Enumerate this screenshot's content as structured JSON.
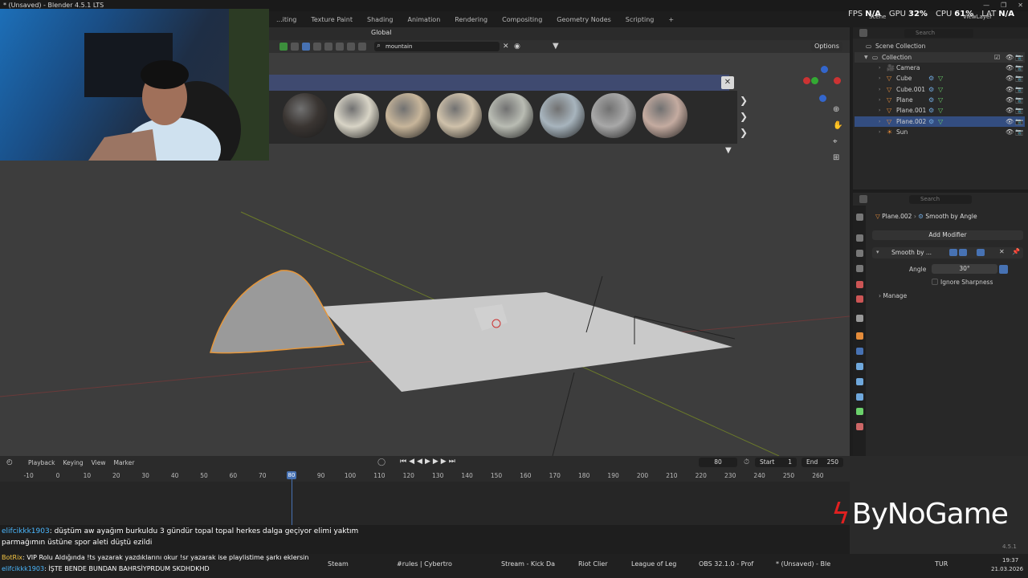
{
  "window": {
    "title": "* (Unsaved) - Blender 4.5.1 LTS"
  },
  "workspace_tabs": [
    "...iting",
    "Texture Paint",
    "Shading",
    "Animation",
    "Rendering",
    "Compositing",
    "Geometry Nodes",
    "Scripting",
    "+"
  ],
  "stats": {
    "fps_label": "FPS",
    "fps": "N/A",
    "gpu_label": "GPU",
    "gpu": "32%",
    "cpu_label": "CPU",
    "cpu": "61%",
    "lat_label": "LAT",
    "lat": "N/A"
  },
  "viewport": {
    "orientation": "Global",
    "search_value": "mountain",
    "options_label": "Options",
    "gizmo_axes": [
      "X",
      "Y",
      "Z"
    ]
  },
  "asset_shelf": {
    "materials": [
      {
        "color": "#3a3532"
      },
      {
        "color": "#d8d4c6"
      },
      {
        "color": "#c7b59a"
      },
      {
        "color": "#cfc1aa"
      },
      {
        "color": "#b9bcb3"
      },
      {
        "color": "#a7b4bd"
      },
      {
        "color": "#a8a8a8"
      },
      {
        "color": "#c4aba0"
      }
    ]
  },
  "outliner": {
    "search_placeholder": "Search",
    "scene_collection": "Scene Collection",
    "collection": "Collection",
    "objects": [
      {
        "name": "Camera",
        "icon": "camera-icon"
      },
      {
        "name": "Cube",
        "icon": "mesh-icon"
      },
      {
        "name": "Cube.001",
        "icon": "mesh-icon"
      },
      {
        "name": "Plane",
        "icon": "mesh-icon"
      },
      {
        "name": "Plane.001",
        "icon": "mesh-icon"
      },
      {
        "name": "Plane.002",
        "icon": "mesh-icon",
        "selected": true
      },
      {
        "name": "Sun",
        "icon": "light-icon"
      }
    ],
    "header_scene": "Scene",
    "header_view_layer": "ViewLayer"
  },
  "properties": {
    "search_placeholder": "Search",
    "breadcrumb_object": "Plane.002",
    "breadcrumb_modifier": "Smooth by Angle",
    "add_modifier_label": "Add Modifier",
    "modifier_name": "Smooth by ...",
    "angle_label": "Angle",
    "angle_value": "30°",
    "ignore_sharpness_label": "Ignore Sharpness",
    "manage_label": "Manage"
  },
  "timeline": {
    "menus": [
      "Playback",
      "Keying",
      "View",
      "Marker"
    ],
    "current_frame": "80",
    "start_label": "Start",
    "start_value": "1",
    "end_label": "End",
    "end_value": "250",
    "ticks": [
      "-10",
      "0",
      "10",
      "20",
      "30",
      "40",
      "50",
      "60",
      "70",
      "80",
      "90",
      "100",
      "110",
      "120",
      "130",
      "140",
      "150",
      "160",
      "170",
      "180",
      "190",
      "200",
      "210",
      "220",
      "230",
      "240",
      "250",
      "260"
    ]
  },
  "chat": {
    "line1_user": "elifcikkk1903",
    "line1_text": ": düştüm aw ayağım burkuldu 3 gündür topal topal herkes dalga geçiyor elimi yaktım",
    "line2_text": "parmağımın üstüne spor aleti düştü ezildi",
    "line3_user": "BotRix",
    "line3_text": ": VIP Rolu Aldığında !ts yazarak yazdıklarını okur !sr yazarak ise playlistime şarkı eklersin",
    "line4_user": "elifcikkk1903",
    "line4_text": ": İŞTE BENDE BUNDAN BAHRSİYPRDUM SKDHDKHD"
  },
  "watermark": "ByNoGame",
  "version_label": "4.5.1",
  "taskbar": {
    "items": [
      "Steam",
      "#rules | Cybertro",
      "Stream - Kick Da",
      "Riot Clier",
      "League of Leg",
      "OBS 32.1.0 - Prof",
      "* (Unsaved) - Ble"
    ],
    "language": "TUR",
    "time": "19:37",
    "date": "21.03.2026"
  }
}
